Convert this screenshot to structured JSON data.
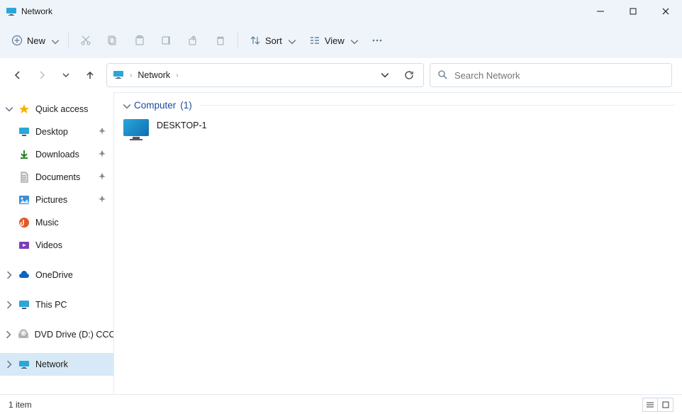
{
  "window": {
    "title": "Network"
  },
  "toolbar": {
    "new_label": "New",
    "sort_label": "Sort",
    "view_label": "View"
  },
  "address": {
    "crumb": "Network"
  },
  "search": {
    "placeholder": "Search Network"
  },
  "sidebar": {
    "quick_access": "Quick access",
    "desktop": "Desktop",
    "downloads": "Downloads",
    "documents": "Documents",
    "pictures": "Pictures",
    "music": "Music",
    "videos": "Videos",
    "onedrive": "OneDrive",
    "this_pc": "This PC",
    "dvd": "DVD Drive (D:) CCCO",
    "network": "Network"
  },
  "content": {
    "group_label": "Computer",
    "group_count": "(1)",
    "items": [
      {
        "name": "DESKTOP-1"
      }
    ]
  },
  "status": {
    "item_count": "1 item"
  }
}
